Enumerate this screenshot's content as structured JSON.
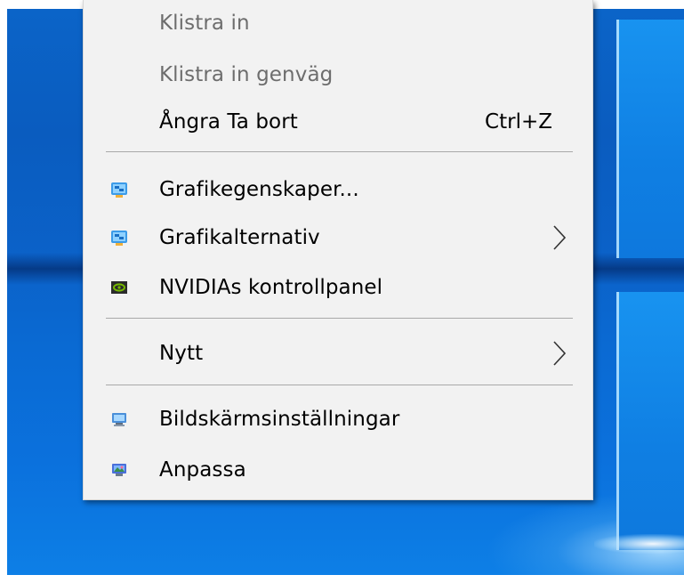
{
  "context_menu": {
    "items": [
      {
        "label": "Klistra in",
        "shortcut": "",
        "enabled": false,
        "submenu": false,
        "icon": ""
      },
      {
        "label": "Klistra in genväg",
        "shortcut": "",
        "enabled": false,
        "submenu": false,
        "icon": ""
      },
      {
        "label": "Ångra Ta bort",
        "shortcut": "Ctrl+Z",
        "enabled": true,
        "submenu": false,
        "icon": ""
      },
      {
        "label": "Grafikegenskaper...",
        "shortcut": "",
        "enabled": true,
        "submenu": false,
        "icon": "intel-graphics-icon"
      },
      {
        "label": "Grafikalternativ",
        "shortcut": "",
        "enabled": true,
        "submenu": true,
        "icon": "intel-graphics-icon"
      },
      {
        "label": "NVIDIAs kontrollpanel",
        "shortcut": "",
        "enabled": true,
        "submenu": false,
        "icon": "nvidia-icon"
      },
      {
        "label": "Nytt",
        "shortcut": "",
        "enabled": true,
        "submenu": true,
        "icon": ""
      },
      {
        "label": "Bildskärmsinställningar",
        "shortcut": "",
        "enabled": true,
        "submenu": false,
        "icon": "display-settings-icon"
      },
      {
        "label": "Anpassa",
        "shortcut": "",
        "enabled": true,
        "submenu": false,
        "icon": "personalize-icon"
      }
    ]
  },
  "colors": {
    "menu_background": "#f2f2f2",
    "disabled_text": "#6d6d6d",
    "separator": "#a9a9a9",
    "wallpaper": "#0b64c8"
  }
}
